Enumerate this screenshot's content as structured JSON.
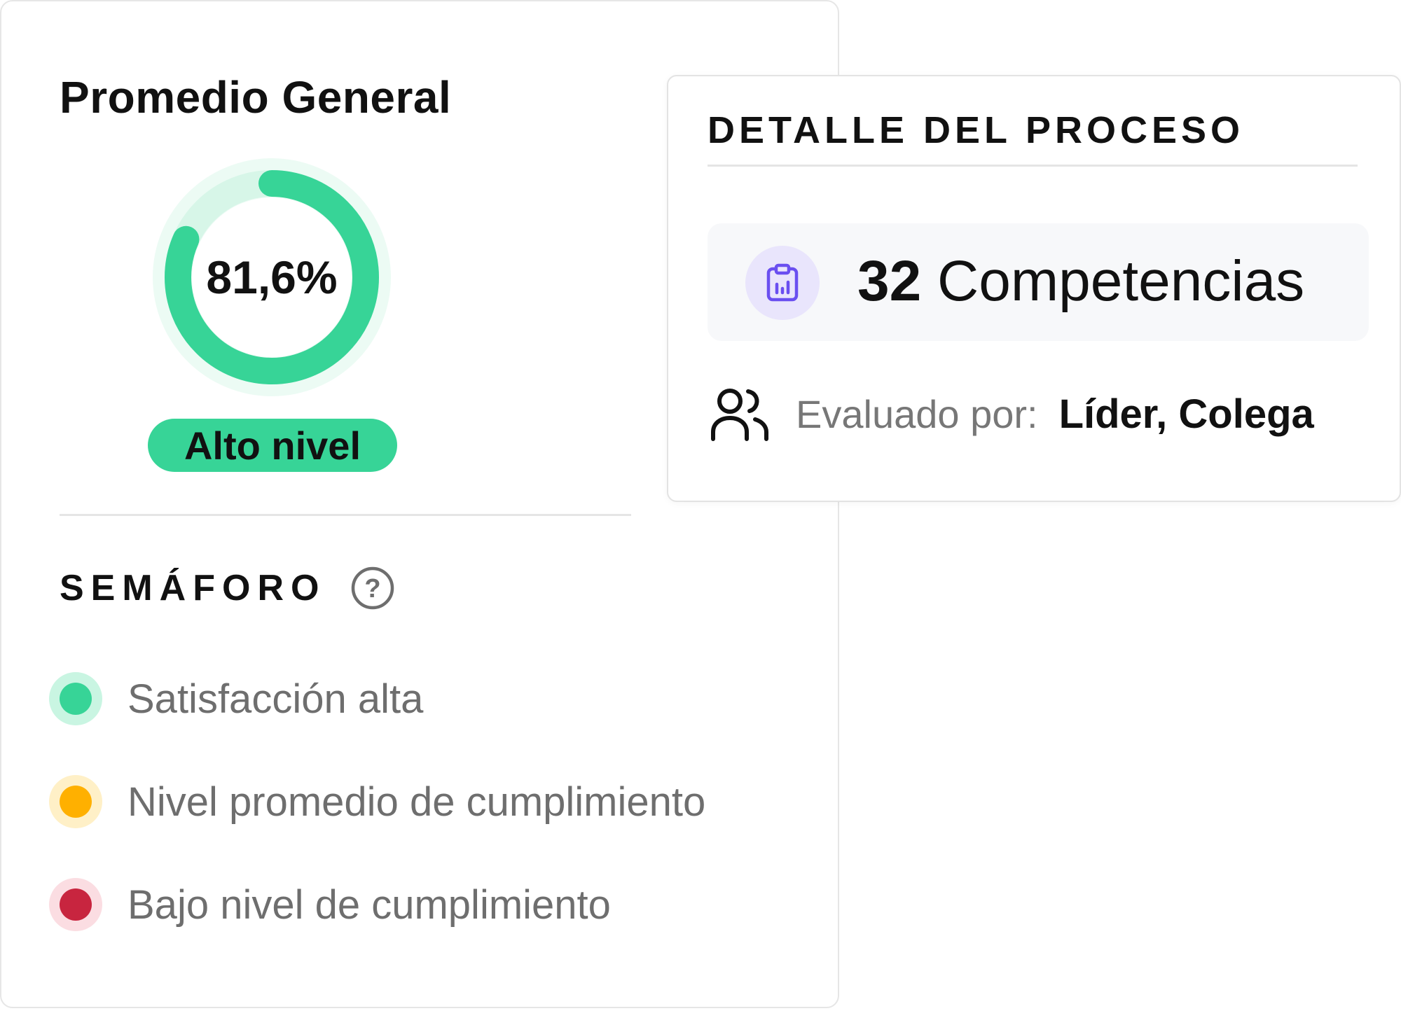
{
  "general": {
    "title": "Promedio General",
    "percentage_text": "81,6%",
    "percentage": 81.6,
    "level_badge": "Alto nivel",
    "accent_color": "#37d497"
  },
  "semaforo": {
    "title": "SEMÁFORO",
    "help_icon": "question-circle-icon",
    "items": [
      {
        "label": "Satisfacción alta",
        "color": "#37d497",
        "halo": "#c9f5e2"
      },
      {
        "label": "Nivel promedio de cumplimiento",
        "color": "#ffb000",
        "halo": "#fff0c7"
      },
      {
        "label": "Bajo nivel de cumplimiento",
        "color": "#c8253f",
        "halo": "#fbdde2"
      }
    ]
  },
  "detail": {
    "title": "DETALLE DEL PROCESO",
    "competencies_icon": "clipboard-chart-icon",
    "competencies_count": "32",
    "competencies_label": "Competencias",
    "evaluators_icon": "people-icon",
    "evaluated_by_label": "Evaluado por:",
    "evaluated_by_value": "Líder, Colega"
  }
}
